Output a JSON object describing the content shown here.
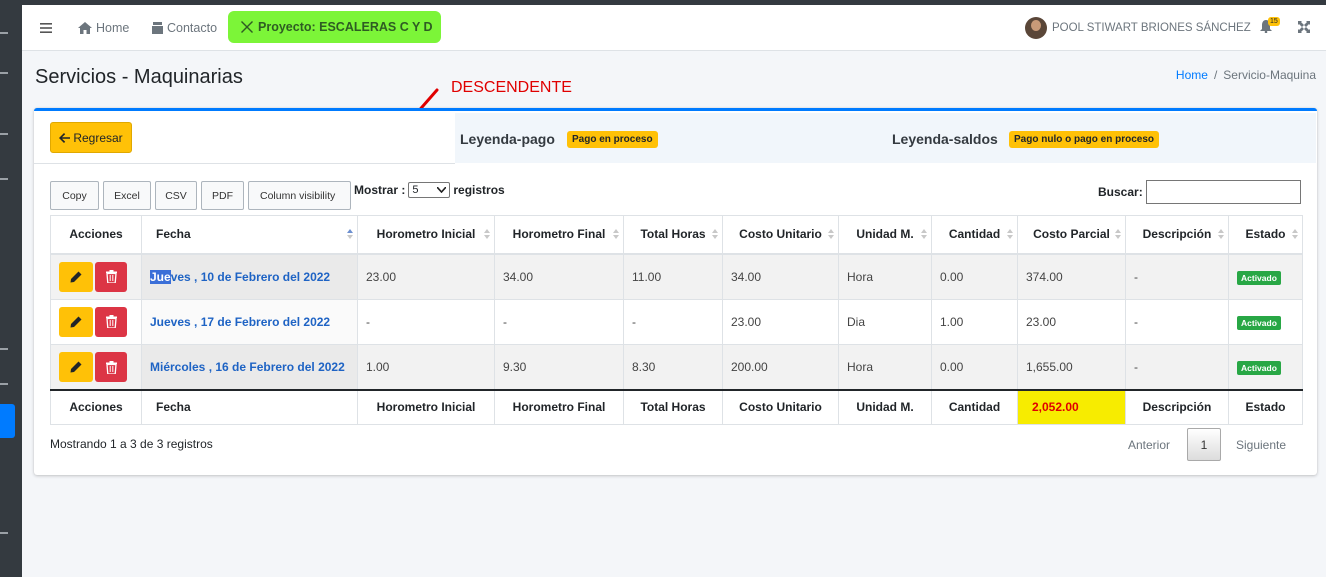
{
  "navbar": {
    "home": "Home",
    "contacto": "Contacto",
    "proyecto": "Proyecto: ESCALERAS C Y D",
    "user_name": "POOL STIWART BRIONES SÁNCHEZ",
    "notif_count": "15"
  },
  "page": {
    "title": "Servicios - Maquinarias",
    "annotation": "DESCENDENTE",
    "breadcrumb": {
      "home": "Home",
      "current": "Servicio-Maquina"
    }
  },
  "card": {
    "regresar": "Regresar",
    "legend_pago_title": "Leyenda-pago",
    "legend_pago_badge": "Pago en proceso",
    "legend_saldos_title": "Leyenda-saldos",
    "legend_saldos_badge": "Pago nulo o pago en proceso"
  },
  "toolbar": {
    "copy": "Copy",
    "excel": "Excel",
    "csv": "CSV",
    "pdf": "PDF",
    "colvis": "Column visibility",
    "mostrar": "Mostrar :",
    "mostrar_value": "5",
    "registros": "registros",
    "buscar": "Buscar:"
  },
  "table": {
    "headers": [
      "Acciones",
      "Fecha",
      "Horometro Inicial",
      "Horometro Final",
      "Total Horas",
      "Costo Unitario",
      "Unidad M.",
      "Cantidad",
      "Costo Parcial",
      "Descripción",
      "Estado"
    ],
    "rows": [
      {
        "fecha_hl": "Jue",
        "fecha_rest": "ves , 10 de Febrero del 2022",
        "hor_ini": "23.00",
        "hor_fin": "34.00",
        "total_horas": "11.00",
        "costo_unit": "34.00",
        "unidad": "Hora",
        "cantidad": "0.00",
        "costo_parcial": "374.00",
        "descripcion": "-",
        "estado": "Activado"
      },
      {
        "fecha_hl": "",
        "fecha_rest": "Jueves , 17 de Febrero del 2022",
        "hor_ini": "-",
        "hor_fin": "-",
        "total_horas": "-",
        "costo_unit": "23.00",
        "unidad": "Dia",
        "cantidad": "1.00",
        "costo_parcial": "23.00",
        "descripcion": "-",
        "estado": "Activado"
      },
      {
        "fecha_hl": "",
        "fecha_rest": "Miércoles , 16 de Febrero del 2022",
        "hor_ini": "1.00",
        "hor_fin": "9.30",
        "total_horas": "8.30",
        "costo_unit": "200.00",
        "unidad": "Hora",
        "cantidad": "0.00",
        "costo_parcial": "1,655.00",
        "descripcion": "-",
        "estado": "Activado"
      }
    ],
    "footer": [
      "Acciones",
      "Fecha",
      "Horometro Inicial",
      "Horometro Final",
      "Total Horas",
      "Costo Unitario",
      "Unidad M.",
      "Cantidad",
      "2,052.00",
      "Descripción",
      "Estado"
    ]
  },
  "pagination": {
    "info": "Mostrando 1 a 3 de 3 registros",
    "anterior": "Anterior",
    "page": "1",
    "siguiente": "Siguiente"
  }
}
